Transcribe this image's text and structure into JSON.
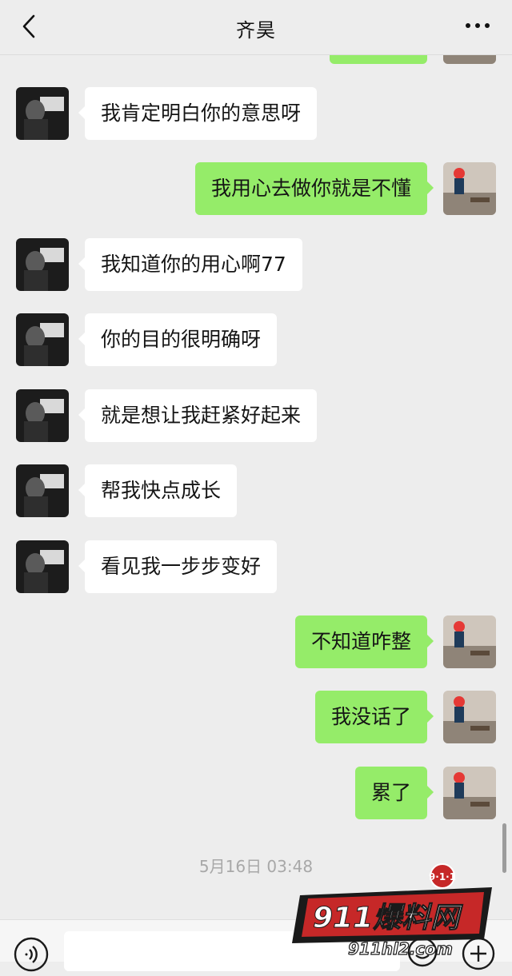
{
  "header": {
    "title": "齐昊",
    "back_icon": "chevron-left-icon",
    "more_icon": "more-dots-icon"
  },
  "messages": [
    {
      "side": "left",
      "text": "我肯定明白你的意思呀"
    },
    {
      "side": "right",
      "text": "我用心去做你就是不懂"
    },
    {
      "side": "left",
      "text": "我知道你的用心啊77"
    },
    {
      "side": "left",
      "text": "你的目的很明确呀"
    },
    {
      "side": "left",
      "text": "就是想让我赶紧好起来"
    },
    {
      "side": "left",
      "text": "帮我快点成长"
    },
    {
      "side": "left",
      "text": "看见我一步步变好"
    },
    {
      "side": "right",
      "text": "不知道咋整"
    },
    {
      "side": "right",
      "text": "我没话了"
    },
    {
      "side": "right",
      "text": "累了"
    }
  ],
  "timestamp": "5月16日 03:48",
  "input": {
    "value": "",
    "voice_icon": "voice-icon",
    "emoji_icon": "emoji-icon",
    "plus_icon": "plus-icon"
  },
  "watermark": {
    "badge": "9·1·1",
    "brand": "911爆料网",
    "url": "911hl2.com"
  },
  "colors": {
    "background": "#ededed",
    "outgoing_bubble": "#95ec69",
    "incoming_bubble": "#ffffff"
  }
}
